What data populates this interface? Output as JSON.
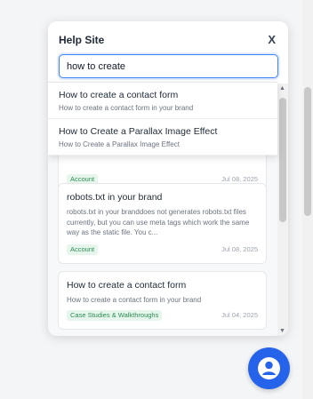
{
  "widget": {
    "title": "Help Site",
    "close_label": "X",
    "search_value": "how to create"
  },
  "suggestions": [
    {
      "title": "How to create a contact form",
      "subtitle": "How to create a contact form in your brand"
    },
    {
      "title": "How to Create a Parallax Image Effect",
      "subtitle": "How to Create a Parallax Image Effect"
    }
  ],
  "articles": [
    {
      "title": "",
      "description": "",
      "category": "Account",
      "date": "Jul 08, 2025"
    },
    {
      "title": "robots.txt in your brand",
      "description": "robots.txt in your branddoes not generates robots.txt files currently, but you can use meta tags which work the same way as the static file. You c...",
      "category": "Account",
      "date": "Jul 08, 2025"
    },
    {
      "title": "How to create a contact form",
      "description": "How to create a contact form in your brand",
      "category": "Case Studies & Walkthroughs",
      "date": "Jul 04, 2025"
    }
  ],
  "colors": {
    "accent": "#2563eb",
    "badge_bg": "#e7f6ec",
    "badge_text": "#2e8b57"
  },
  "icons": {
    "launcher": "user-icon",
    "scroll_up": "chevron-up-icon",
    "scroll_down": "chevron-down-icon"
  }
}
